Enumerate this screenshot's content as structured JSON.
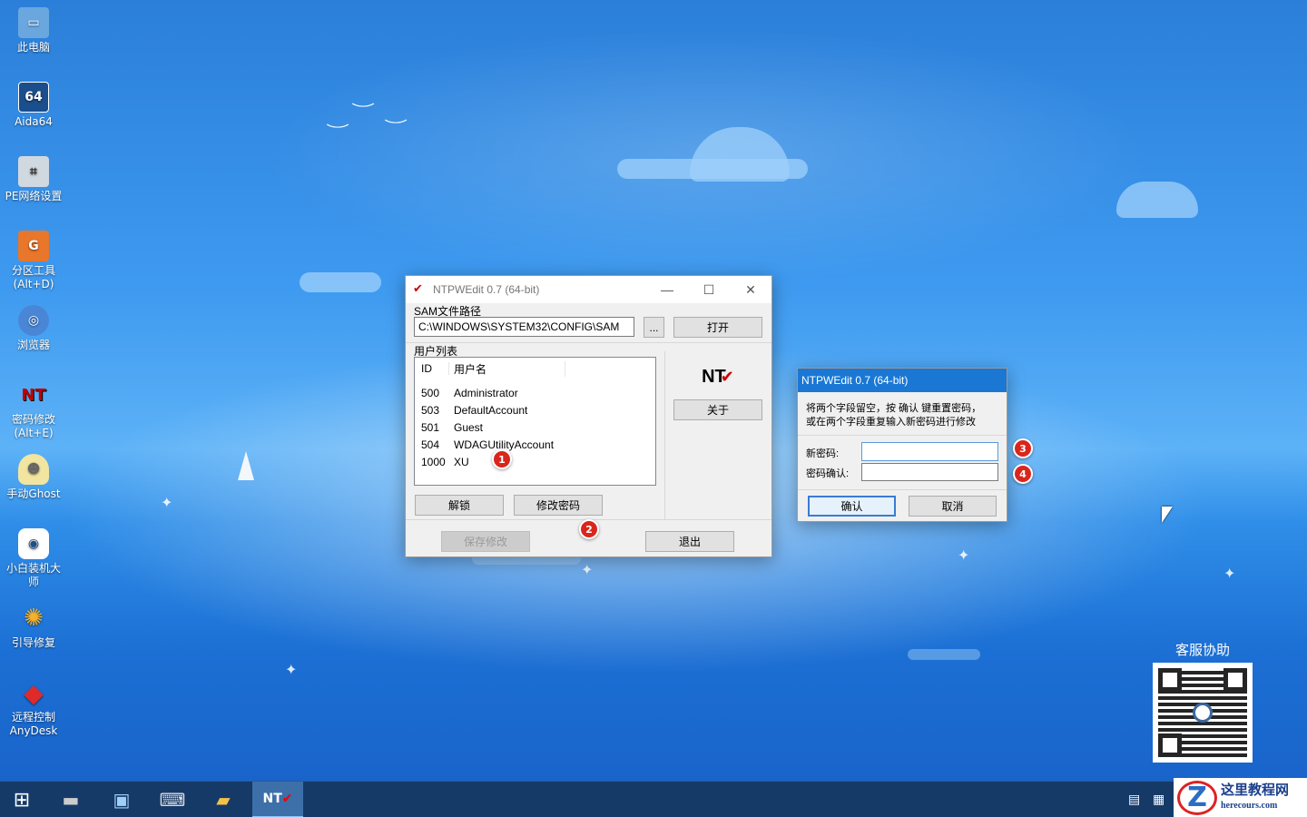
{
  "desktop_icons": [
    {
      "label": "此电脑",
      "icon": "computer-icon",
      "color": "#6aa7df"
    },
    {
      "label": "Aida64",
      "icon": "aida64-icon",
      "glyph": "64",
      "color": "#1a4e8c"
    },
    {
      "label": "PE网络设置",
      "icon": "network-icon",
      "color": "#d0d8e0"
    },
    {
      "label": "分区工具\n(Alt+D)",
      "line1": "分区工具",
      "line2": "(Alt+D)",
      "icon": "partition-tool-icon",
      "color": "#e8762b"
    },
    {
      "label": "浏览器",
      "icon": "browser-icon",
      "color": "#4a86d6"
    },
    {
      "label": "密码修改\n(Alt+E)",
      "line1": "密码修改",
      "line2": "(Alt+E)",
      "icon": "password-change-icon",
      "color": "#b00000"
    },
    {
      "label": "手动Ghost",
      "icon": "ghost-icon",
      "color": "#f1e5a0"
    },
    {
      "label": "小白装机大\n师",
      "line1": "小白装机大",
      "line2": "师",
      "icon": "xiaobai-icon",
      "color": "#ffffff"
    },
    {
      "label": "引导修复",
      "icon": "boot-repair-icon",
      "color": "#f3b12c"
    },
    {
      "label": "远程控制\nAnyDesk",
      "line1": "远程控制",
      "line2": "AnyDesk",
      "icon": "anydesk-icon",
      "color": "#e02a2a"
    }
  ],
  "main_window": {
    "title": "NTPWEdit 0.7 (64-bit)",
    "sam_label": "SAM文件路径",
    "sam_path": "C:\\WINDOWS\\SYSTEM32\\CONFIG\\SAM",
    "browse_label": "...",
    "open_label": "打开",
    "user_list_label": "用户列表",
    "columns": [
      "ID",
      "用户名"
    ],
    "users": [
      {
        "id": "500",
        "name": "Administrator"
      },
      {
        "id": "503",
        "name": "DefaultAccount"
      },
      {
        "id": "501",
        "name": "Guest"
      },
      {
        "id": "504",
        "name": "WDAGUtilityAccount"
      },
      {
        "id": "1000",
        "name": "XU"
      }
    ],
    "logo_text": "NT",
    "about_label": "关于",
    "unlock_label": "解锁",
    "change_password_label": "修改密码",
    "save_label": "保存修改",
    "exit_label": "退出"
  },
  "dialog": {
    "title": "NTPWEdit 0.7 (64-bit)",
    "hint_line1": "将两个字段留空，按 确认 键重置密码，",
    "hint_line2": "或在两个字段重复输入新密码进行修改",
    "new_password_label": "新密码:",
    "new_password_value": "",
    "confirm_password_label": "密码确认:",
    "confirm_password_value": "",
    "ok_label": "确认",
    "cancel_label": "取消"
  },
  "markers": [
    "1",
    "2",
    "3",
    "4"
  ],
  "support": {
    "label": "客服协助"
  },
  "watermark": {
    "title": "这里教程网",
    "url": "herecours.com"
  },
  "taskbar": {
    "items": [
      "start-icon",
      "ram-drive-icon",
      "network-settings-icon",
      "keyboard-icon",
      "file-explorer-icon",
      "ntpwedit-icon"
    ],
    "active": "ntpwedit-icon"
  }
}
